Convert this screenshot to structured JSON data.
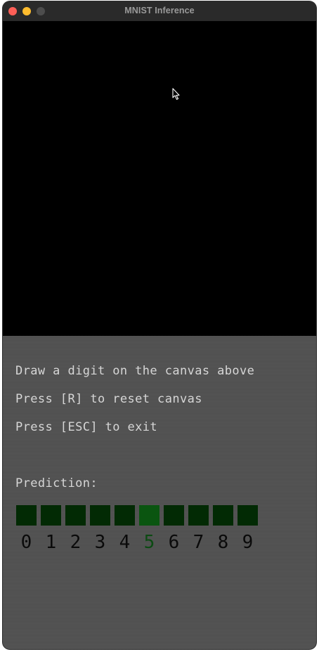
{
  "window": {
    "title": "MNIST Inference"
  },
  "instructions": {
    "line1": "Draw a digit on the canvas above",
    "line2": "Press [R] to reset canvas",
    "line3": "Press [ESC] to exit"
  },
  "prediction": {
    "label": "Prediction:",
    "digits": [
      "0",
      "1",
      "2",
      "3",
      "4",
      "5",
      "6",
      "7",
      "8",
      "9"
    ],
    "predicted_digit": "5",
    "box_color": "#022a04",
    "active_box_color": "#0a5510"
  },
  "colors": {
    "canvas": "#000000",
    "panel": "#515151",
    "text": "#d6d6d6"
  }
}
